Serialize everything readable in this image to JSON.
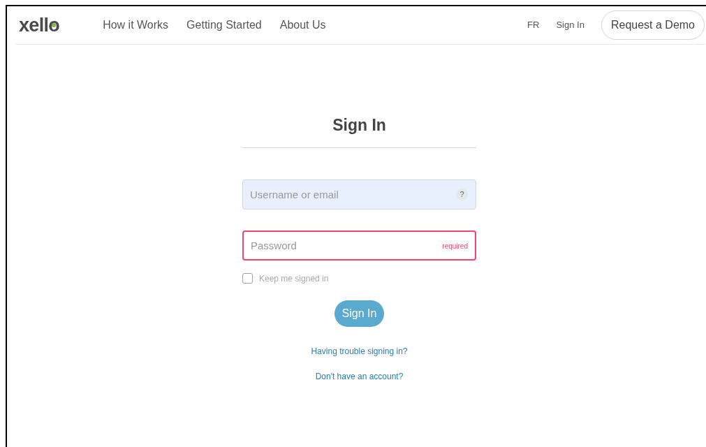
{
  "header": {
    "logo": "xello",
    "nav": [
      "How it Works",
      "Getting Started",
      "About Us"
    ],
    "language": "FR",
    "sign_in_link": "Sign In",
    "demo_button": "Request a Demo"
  },
  "form": {
    "title": "Sign In",
    "username": {
      "placeholder": "Username or email",
      "help": "?",
      "autofilled": true
    },
    "password": {
      "placeholder": "Password",
      "error": "required",
      "invalid": true
    },
    "remember": {
      "label": "Keep me signed in",
      "checked": false
    },
    "submit": "Sign In",
    "links": [
      "Having trouble signing in?",
      "Don't have an account?"
    ]
  }
}
